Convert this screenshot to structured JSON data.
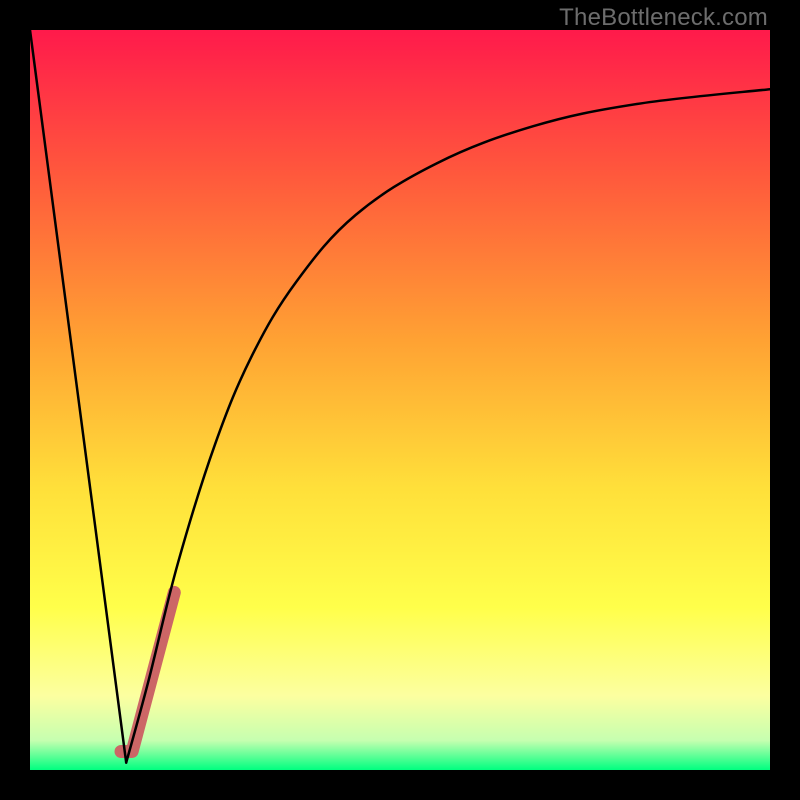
{
  "watermark": "TheBottleneck.com",
  "chart_data": {
    "type": "line",
    "title": "",
    "xlabel": "",
    "ylabel": "",
    "xlim": [
      0,
      100
    ],
    "ylim": [
      0,
      100
    ],
    "grid": false,
    "legend": false,
    "gradient_stops": [
      {
        "offset": 0,
        "color": "#ff1a4b"
      },
      {
        "offset": 20,
        "color": "#ff5a3c"
      },
      {
        "offset": 42,
        "color": "#ffa233"
      },
      {
        "offset": 62,
        "color": "#ffe03a"
      },
      {
        "offset": 78,
        "color": "#ffff4a"
      },
      {
        "offset": 90,
        "color": "#fcffa0"
      },
      {
        "offset": 96,
        "color": "#c6ffb0"
      },
      {
        "offset": 100,
        "color": "#00ff80"
      }
    ],
    "series": [
      {
        "name": "descending-line",
        "color": "#000000",
        "width": 2.5,
        "data": [
          {
            "x": 0,
            "y": 100
          },
          {
            "x": 13,
            "y": 1
          }
        ]
      },
      {
        "name": "rising-curve",
        "color": "#000000",
        "width": 2.5,
        "data": [
          {
            "x": 13,
            "y": 1
          },
          {
            "x": 16,
            "y": 12
          },
          {
            "x": 20,
            "y": 28
          },
          {
            "x": 25,
            "y": 44
          },
          {
            "x": 30,
            "y": 56
          },
          {
            "x": 36,
            "y": 66
          },
          {
            "x": 44,
            "y": 75
          },
          {
            "x": 55,
            "y": 82
          },
          {
            "x": 68,
            "y": 87
          },
          {
            "x": 82,
            "y": 90
          },
          {
            "x": 100,
            "y": 92
          }
        ]
      },
      {
        "name": "highlight-segment",
        "color": "#cc6666",
        "width": 13,
        "data": [
          {
            "x": 12.3,
            "y": 2.5
          },
          {
            "x": 13.8,
            "y": 2.5
          },
          {
            "x": 19.5,
            "y": 24
          }
        ]
      }
    ]
  }
}
